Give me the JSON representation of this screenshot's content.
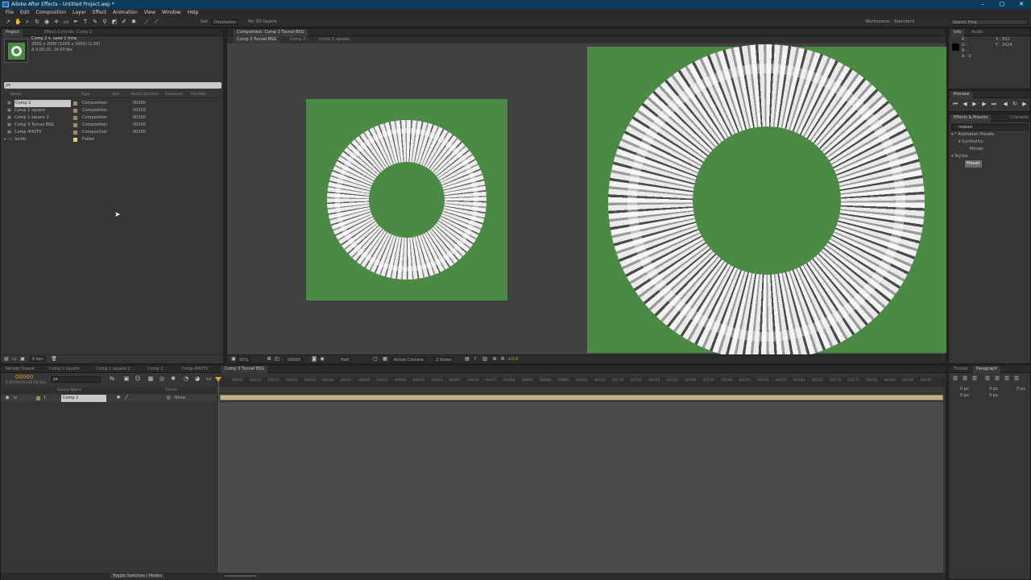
{
  "window": {
    "title": "Adobe After Effects - Untitled Project.aep *",
    "buttons": [
      "–",
      "▢",
      "✕"
    ]
  },
  "menu": [
    "File",
    "Edit",
    "Composition",
    "Layer",
    "Effect",
    "Animation",
    "View",
    "Window",
    "Help"
  ],
  "toolbar": {
    "snapping_label": "Set",
    "orientation_value": "Orientation",
    "for3d_label": "for 3D layers",
    "workspace_label": "Workspace:",
    "workspace_value": "Standard",
    "search_placeholder": "Search Help"
  },
  "project": {
    "tabs": [
      "Project",
      "Effect Controls: Comp 2"
    ],
    "selected_name": "Comp 2 ▾, used 1 time",
    "selected_size": "2000 x 2000 (1000 x 1000) (1.00)",
    "selected_duration": "Δ 0;00;20, 24.00 fps",
    "search_placeholder": "ρ▾",
    "columns": [
      "Name",
      "Type",
      "Size",
      "Media Duration",
      "Comment",
      "File Path"
    ],
    "items": [
      {
        "name": "Comp 2",
        "type": "Composition",
        "duration": "00200",
        "selected": true
      },
      {
        "name": "Comp 1 square",
        "type": "Composition",
        "duration": "00200"
      },
      {
        "name": "Comp 1 square 2",
        "type": "Composition",
        "duration": "00200"
      },
      {
        "name": "Comp 3 Tunnel BSG",
        "type": "Composition",
        "duration": "00200"
      },
      {
        "name": "Comp 4HDTV",
        "type": "Composition",
        "duration": "00200"
      },
      {
        "name": "Solids",
        "type": "Folder",
        "duration": ""
      }
    ],
    "footer_bpc": "8 bpc"
  },
  "composition": {
    "tab_label": "Composition: Comp 3 Tunnel BSG",
    "breadcrumbs": [
      "Comp 3 Tunnel BSG",
      "Comp 2",
      "Comp 1 square"
    ],
    "zoom": "50%",
    "timecode": "00000",
    "resolution": "Half",
    "camera": "Active Camera",
    "views": "2 Views",
    "exposure": "+0.0"
  },
  "info": {
    "tabs": [
      "Info",
      "Audio"
    ],
    "r": "R :",
    "g": "G :",
    "b": "B :",
    "a": "A : 0",
    "x": "X : 832",
    "y": "Y : 2024"
  },
  "preview": {
    "tab": "Preview"
  },
  "effects": {
    "tabs": [
      "Effects & Presets",
      "Characte"
    ],
    "search_value": "mosaic",
    "tree": [
      {
        "label": "▾ * Animation Presets",
        "indent": 0
      },
      {
        "label": "▾ Synthetics",
        "indent": 1
      },
      {
        "label": "Mosaic",
        "indent": 2
      },
      {
        "label": "▾ Stylize",
        "indent": 0
      },
      {
        "label": "Mosaic",
        "indent": 1,
        "highlight": true
      }
    ]
  },
  "timeline": {
    "tabs": [
      "Render Queue",
      "Comp 1 square",
      "Comp 1 square 2",
      "Comp 2",
      "Comp 4HDTV",
      "Comp 3 Tunnel BSG"
    ],
    "timecode": "00000",
    "timecode_sub": "0:00:00:00 (25.00 fps)",
    "search_placeholder": "ρ▾",
    "columns": [
      "Source Name",
      "Parent"
    ],
    "layer": {
      "index": "1",
      "name": "Comp 2",
      "parent": "None"
    },
    "ticks": [
      "00005",
      "00010",
      "00015",
      "00020",
      "00025",
      "00030",
      "00035",
      "00040",
      "00045",
      "00050",
      "00055",
      "00060",
      "00065",
      "00070",
      "00075",
      "00080",
      "00085",
      "00090",
      "00095",
      "00100",
      "00105",
      "00110",
      "00115",
      "00120",
      "00125",
      "00130",
      "00135",
      "00140",
      "00145",
      "00150",
      "00155",
      "00160",
      "00165",
      "00170",
      "00175",
      "00180",
      "00185",
      "00190",
      "00195"
    ],
    "toggle_label": "Toggle Switches / Modes"
  },
  "tracker": {
    "tabs": [
      "Tracker",
      "Paragraph"
    ],
    "px_labels": [
      "0 px",
      "0 px",
      "0 px",
      "0 px",
      "0 px"
    ]
  },
  "colors": {
    "green": "#4a8a44",
    "accent": "#e6a020",
    "bg": "#353535"
  }
}
